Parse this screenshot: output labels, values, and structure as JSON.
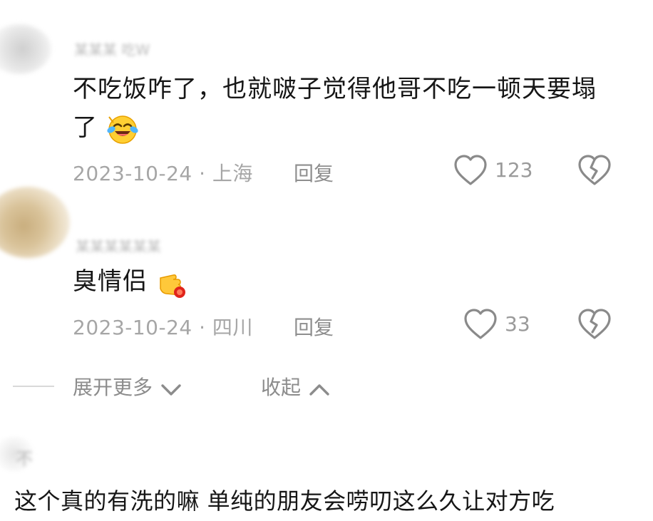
{
  "comments": [
    {
      "username": "某某某 吃W",
      "text_line1": "不吃饭咋了，也就啵子觉得他哥不吃一顿天要塌",
      "text_line2": "了",
      "emoji": "laughing-crying-emoji",
      "date_location": "2023-10-24 · 上海",
      "reply_label": "回复",
      "like_count": "123",
      "like_icon": "heart-outline-icon",
      "dislike_icon": "broken-heart-icon"
    },
    {
      "username": "某某某某某某",
      "text": "臭情侣",
      "emoji": "pointing-hand-emoji",
      "date_location": "2023-10-24 · 四川",
      "reply_label": "回复",
      "like_count": "33",
      "like_icon": "heart-outline-icon",
      "dislike_icon": "broken-heart-icon"
    }
  ],
  "thread_controls": {
    "expand_label": "展开更多",
    "collapse_label": "收起"
  },
  "next_comment": {
    "username": "不",
    "text": "这个真的有洗的嘛 单纯的朋友会唠叨这么久让对方吃"
  },
  "colors": {
    "text": "#161616",
    "meta": "#a6a6a6",
    "icon": "#8c8c8c"
  }
}
